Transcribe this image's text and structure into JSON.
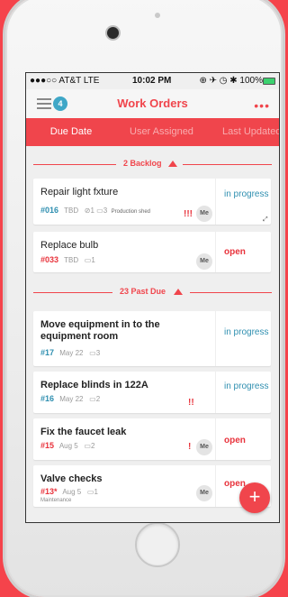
{
  "status_bar": {
    "carrier": "●●●○○ AT&T  LTE",
    "time": "10:02 PM",
    "right": "⊕ ✈ ◷ ✱ 100%"
  },
  "navbar": {
    "badge_count": "4",
    "title": "Work Orders",
    "more": "•••"
  },
  "tabs": [
    "Due Date",
    "User Assigned",
    "Last Updated"
  ],
  "sections": {
    "backlog": {
      "count": "2",
      "label": "Backlog"
    },
    "past_due": {
      "count": "23",
      "label": "Past Due"
    }
  },
  "cards": [
    {
      "title": "Repair light fxture",
      "number": "#016",
      "due": "TBD",
      "attachments": "1",
      "comments": "3",
      "location": "Production shed",
      "priority": "!!!",
      "assignee": "Me",
      "status": "in progress"
    },
    {
      "title": "Replace bulb",
      "number": "#033",
      "due": "TBD",
      "comments": "1",
      "assignee": "Me",
      "status": "open"
    },
    {
      "title": "Move equipment in to the equipment room",
      "number": "#17",
      "due": "May 22",
      "comments": "3",
      "status": "in progress"
    },
    {
      "title": "Replace blinds in 122A",
      "number": "#16",
      "due": "May 22",
      "comments": "2",
      "priority": "!!",
      "status": "in progress"
    },
    {
      "title": "Fix the faucet leak",
      "number": "#15",
      "due": "Aug 5",
      "comments": "2",
      "priority": "!",
      "assignee": "Me",
      "status": "open"
    },
    {
      "title": "Valve checks",
      "number": "#13*",
      "due": "Aug 5",
      "comments": "1",
      "location": "Maintenance",
      "assignee": "Me",
      "status": "open"
    }
  ],
  "icons": {
    "menu": "hamburger-icon",
    "more": "ellipsis-icon",
    "collapse": "triangle-up-icon",
    "attachment": "paperclip-icon",
    "comment": "comment-icon",
    "add": "plus-icon"
  },
  "colors": {
    "accent": "#f0454c",
    "link_blue": "#2f8fb0"
  },
  "fab_label": "+"
}
